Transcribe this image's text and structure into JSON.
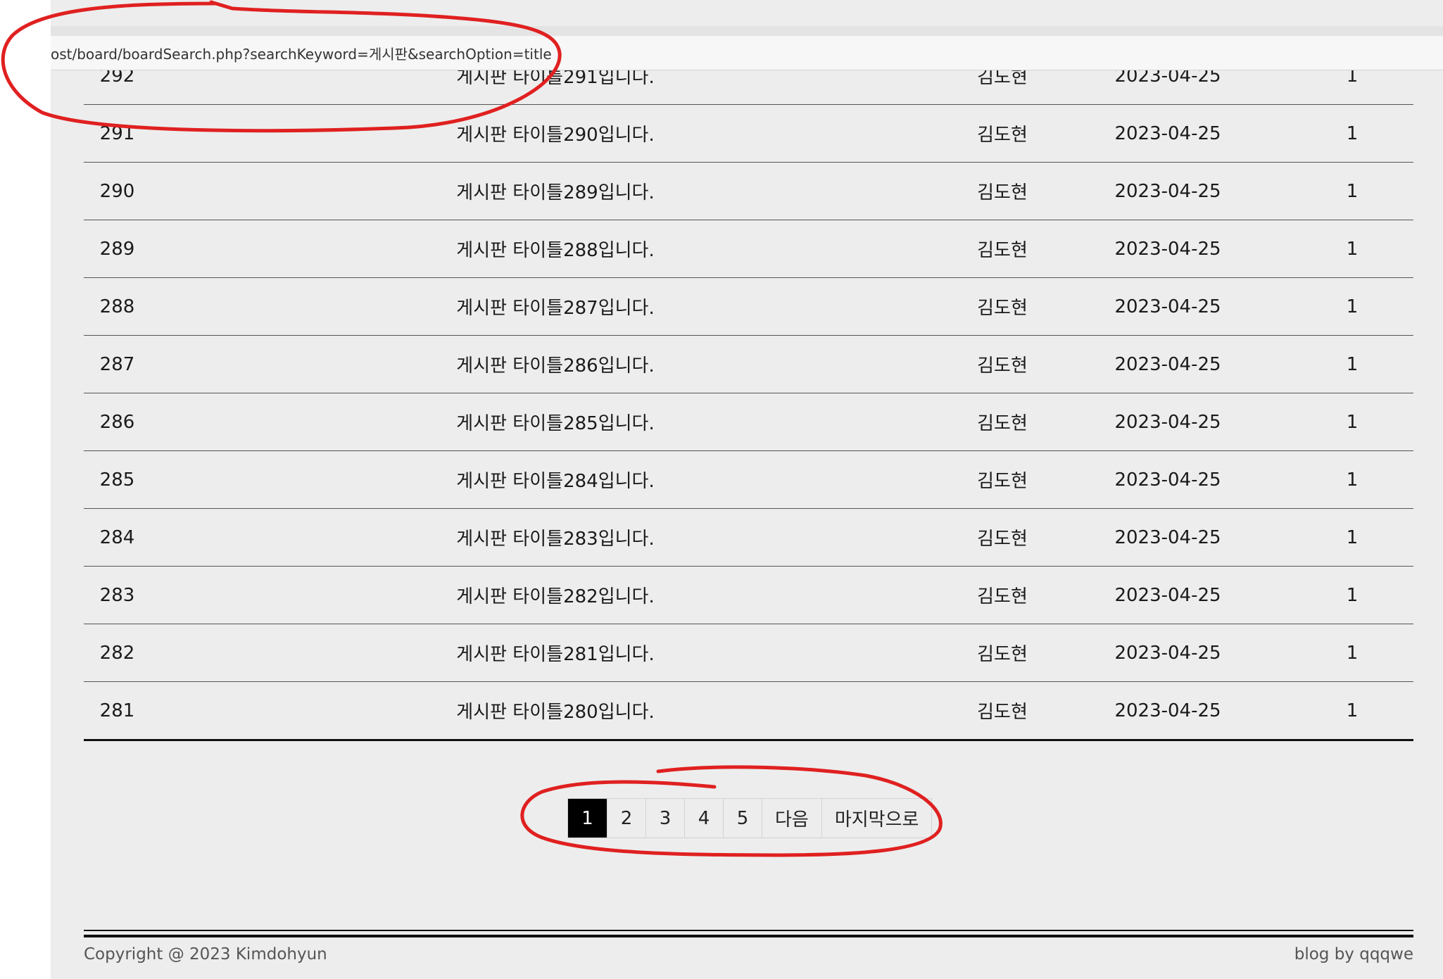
{
  "browser": {
    "url": "ost/board/boardSearch.php?searchKeyword=게시판&searchOption=title"
  },
  "board": {
    "rows": [
      {
        "num": "292",
        "title": "게시판 타이틀291입니다.",
        "author": "김도현",
        "date": "2023-04-25",
        "views": "1"
      },
      {
        "num": "291",
        "title": "게시판 타이틀290입니다.",
        "author": "김도현",
        "date": "2023-04-25",
        "views": "1"
      },
      {
        "num": "290",
        "title": "게시판 타이틀289입니다.",
        "author": "김도현",
        "date": "2023-04-25",
        "views": "1"
      },
      {
        "num": "289",
        "title": "게시판 타이틀288입니다.",
        "author": "김도현",
        "date": "2023-04-25",
        "views": "1"
      },
      {
        "num": "288",
        "title": "게시판 타이틀287입니다.",
        "author": "김도현",
        "date": "2023-04-25",
        "views": "1"
      },
      {
        "num": "287",
        "title": "게시판 타이틀286입니다.",
        "author": "김도현",
        "date": "2023-04-25",
        "views": "1"
      },
      {
        "num": "286",
        "title": "게시판 타이틀285입니다.",
        "author": "김도현",
        "date": "2023-04-25",
        "views": "1"
      },
      {
        "num": "285",
        "title": "게시판 타이틀284입니다.",
        "author": "김도현",
        "date": "2023-04-25",
        "views": "1"
      },
      {
        "num": "284",
        "title": "게시판 타이틀283입니다.",
        "author": "김도현",
        "date": "2023-04-25",
        "views": "1"
      },
      {
        "num": "283",
        "title": "게시판 타이틀282입니다.",
        "author": "김도현",
        "date": "2023-04-25",
        "views": "1"
      },
      {
        "num": "282",
        "title": "게시판 타이틀281입니다.",
        "author": "김도현",
        "date": "2023-04-25",
        "views": "1"
      },
      {
        "num": "281",
        "title": "게시판 타이틀280입니다.",
        "author": "김도현",
        "date": "2023-04-25",
        "views": "1"
      }
    ]
  },
  "pagination": {
    "pages": [
      "1",
      "2",
      "3",
      "4",
      "5"
    ],
    "active_page": "1",
    "next_label": "다음",
    "last_label": "마지막으로"
  },
  "footer": {
    "copyright": "Copyright @ 2023 Kimdohyun",
    "credit": "blog by qqqwe"
  },
  "colors": {
    "page_background": "#ededed",
    "active_page": "#000000",
    "annotation": "#e02020"
  }
}
